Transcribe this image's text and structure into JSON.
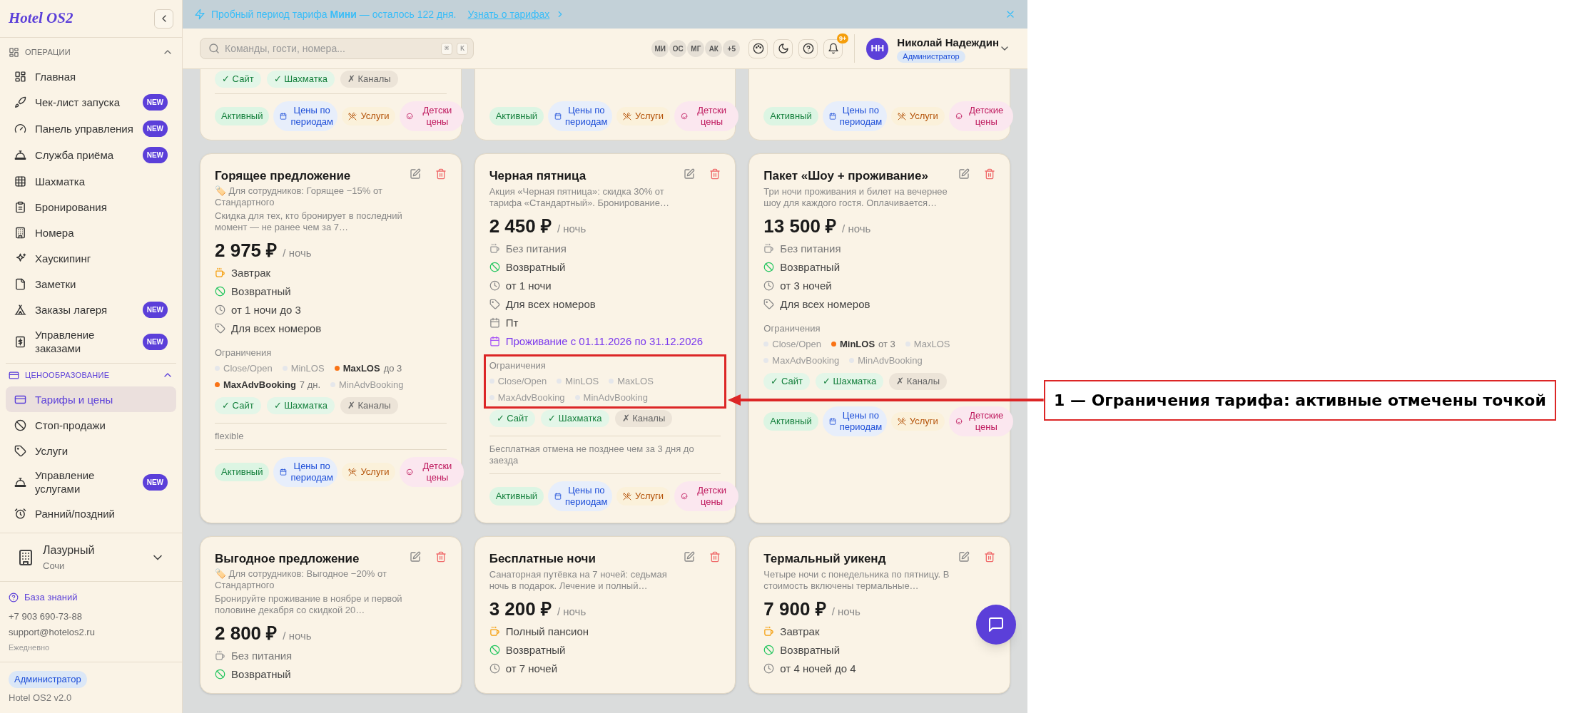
{
  "banner": {
    "text": "Пробный период тарифа **Мини** — осталось 122 дня.",
    "link": "Узнать о тарифах"
  },
  "sidebar": {
    "logo": "Hotel OS2",
    "sections": [
      {
        "title": "ОПЕРАЦИИ",
        "expanded": true,
        "items": [
          {
            "label": "Главная",
            "selected": false
          },
          {
            "label": "Чек-лист запуска",
            "badge": "NEW",
            "selected": false
          },
          {
            "label": "Панель управления",
            "badge": "NEW",
            "selected": false
          },
          {
            "label": "Служба приёма",
            "badge": "NEW",
            "selected": false
          },
          {
            "label": "Шахматка",
            "selected": false
          },
          {
            "label": "Бронирования",
            "selected": false
          },
          {
            "label": "Номера",
            "selected": false
          },
          {
            "label": "Хаускипинг",
            "selected": false
          },
          {
            "label": "Заметки",
            "selected": false
          },
          {
            "label": "Заказы лагеря",
            "badge": "NEW",
            "selected": false
          },
          {
            "label": "Управление заказами",
            "badge": "NEW",
            "selected": false
          }
        ]
      },
      {
        "title": "ЦЕНООБРАЗОВАНИЕ",
        "expanded": true,
        "items": [
          {
            "label": "Тарифы и цены",
            "selected": true
          },
          {
            "label": "Стоп-продажи",
            "selected": false
          },
          {
            "label": "Услуги",
            "selected": false
          },
          {
            "label": "Управление услугами",
            "badge": "NEW",
            "selected": false
          },
          {
            "label": "Ранний/поздний",
            "selected": false
          }
        ]
      }
    ],
    "hotel": {
      "name": "Лазурный",
      "city": "Сочи"
    },
    "support": {
      "link": "База знаний",
      "phone": "+7 903 690-73-88",
      "email": "support@hotelos2.ru",
      "hours": "Ежедневно"
    },
    "role": "Администратор",
    "version": "Hotel OS2 v2.0"
  },
  "header": {
    "search_placeholder": "Команды, гости, номера...",
    "keys": [
      "⌘",
      "K"
    ],
    "avatars": [
      "МИ",
      "ОС",
      "МГ",
      "АК"
    ],
    "more": "+5",
    "notifications": "9+",
    "user": {
      "initials": "НН",
      "name": "Николай Надеждин",
      "role": "Администратор"
    }
  },
  "top_cards": [
    {
      "channels": [
        {
          "label": "✓ Сайт",
          "enabled": true
        },
        {
          "label": "✓ Шахматка",
          "enabled": true
        },
        {
          "label": "✗ Каналы",
          "enabled": false
        }
      ],
      "statuses": [
        {
          "kind": "status",
          "text": "Активный"
        },
        {
          "kind": "periods",
          "text": "Цены по периодам"
        },
        {
          "kind": "services",
          "text": "Услуги"
        },
        {
          "kind": "kids",
          "text": "Детски цены"
        }
      ]
    },
    {
      "statuses": [
        {
          "kind": "status",
          "text": "Активный"
        },
        {
          "kind": "periods",
          "text": "Цены по периодам"
        },
        {
          "kind": "services",
          "text": "Услуги"
        },
        {
          "kind": "kids",
          "text": "Детски цены"
        }
      ]
    },
    {
      "statuses": [
        {
          "kind": "status",
          "text": "Активный"
        },
        {
          "kind": "periods",
          "text": "Цены по периодам"
        },
        {
          "kind": "services",
          "text": "Услуги"
        },
        {
          "kind": "kids",
          "text": "Детские цены"
        }
      ]
    }
  ],
  "cards": [
    {
      "title": "Горящее предложение",
      "staff_note": "🏷️ Для сотрудников: Горящее −15% от Стандартного",
      "description": "Скидка для тех, кто бронирует в последний момент — не ранее чем за 7…",
      "price": "2 975 ₽",
      "unit": "/ ночь",
      "features": [
        {
          "kind": "meal",
          "text": "Завтрак",
          "included": true
        },
        {
          "kind": "refund",
          "text": "Возвратный"
        },
        {
          "kind": "stay",
          "text": "от 1 ночи до 3"
        },
        {
          "kind": "rooms",
          "text": "Для всех номеров"
        }
      ],
      "restrictions_title": "Ограничения",
      "highlighted": false,
      "restrictions": [
        {
          "label": "Close/Open",
          "active": false
        },
        {
          "label": "MinLOS",
          "active": false
        },
        {
          "label": "MaxLOS",
          "value": "до 3",
          "active": true
        },
        {
          "label": "MaxAdvBooking",
          "value": "7 дн.",
          "active": true
        },
        {
          "label": "MinAdvBooking",
          "active": false
        }
      ],
      "channels": [
        {
          "label": "✓ Сайт",
          "enabled": true
        },
        {
          "label": "✓ Шахматка",
          "enabled": true
        },
        {
          "label": "✗ Каналы",
          "enabled": false
        }
      ],
      "note": "flexible",
      "statuses": [
        {
          "kind": "status",
          "text": "Активный"
        },
        {
          "kind": "periods",
          "text": "Цены по периодам"
        },
        {
          "kind": "services",
          "text": "Услуги"
        },
        {
          "kind": "kids",
          "text": "Детски цены"
        }
      ]
    },
    {
      "title": "Черная пятница",
      "description": "Акция «Черная пятница»: скидка 30% от тарифа «Стандартный». Бронирование…",
      "price": "2 450 ₽",
      "unit": "/ ночь",
      "features": [
        {
          "kind": "meal",
          "text": "Без питания",
          "included": false
        },
        {
          "kind": "refund",
          "text": "Возвратный"
        },
        {
          "kind": "stay",
          "text": "от 1 ночи"
        },
        {
          "kind": "rooms",
          "text": "Для всех номеров"
        },
        {
          "kind": "days",
          "text": "Пт"
        },
        {
          "kind": "period",
          "text": "Проживание с 01.11.2026 по 31.12.2026"
        }
      ],
      "restrictions_title": "Ограничения",
      "highlighted": true,
      "restrictions": [
        {
          "label": "Close/Open",
          "active": false
        },
        {
          "label": "MinLOS",
          "active": false
        },
        {
          "label": "MaxLOS",
          "active": false
        },
        {
          "label": "MaxAdvBooking",
          "active": false
        },
        {
          "label": "MinAdvBooking",
          "active": false
        }
      ],
      "channels": [
        {
          "label": "✓ Сайт",
          "enabled": true
        },
        {
          "label": "✓ Шахматка",
          "enabled": true
        },
        {
          "label": "✗ Каналы",
          "enabled": false
        }
      ],
      "note": "Бесплатная отмена не позднее чем за 3 дня до заезда",
      "statuses": [
        {
          "kind": "status",
          "text": "Активный"
        },
        {
          "kind": "periods",
          "text": "Цены по периодам"
        },
        {
          "kind": "services",
          "text": "Услуги"
        },
        {
          "kind": "kids",
          "text": "Детски цены"
        }
      ]
    },
    {
      "title": "Пакет «Шоу + проживание»",
      "description": "Три ночи проживания и билет на вечернее шоу для каждого гостя. Оплачивается…",
      "price": "13 500 ₽",
      "unit": "/ ночь",
      "features": [
        {
          "kind": "meal",
          "text": "Без питания",
          "included": false
        },
        {
          "kind": "refund",
          "text": "Возвратный"
        },
        {
          "kind": "stay",
          "text": "от 3 ночей"
        },
        {
          "kind": "rooms",
          "text": "Для всех номеров"
        }
      ],
      "restrictions_title": "Ограничения",
      "highlighted": false,
      "restrictions": [
        {
          "label": "Close/Open",
          "active": false
        },
        {
          "label": "MinLOS",
          "value": "от 3",
          "active": true
        },
        {
          "label": "MaxLOS",
          "active": false
        },
        {
          "label": "MaxAdvBooking",
          "active": false
        },
        {
          "label": "MinAdvBooking",
          "active": false
        }
      ],
      "channels": [
        {
          "label": "✓ Сайт",
          "enabled": true
        },
        {
          "label": "✓ Шахматка",
          "enabled": true
        },
        {
          "label": "✗ Каналы",
          "enabled": false
        }
      ],
      "statuses": [
        {
          "kind": "status",
          "text": "Активный"
        },
        {
          "kind": "periods",
          "text": "Цены по периодам"
        },
        {
          "kind": "services",
          "text": "Услуги"
        },
        {
          "kind": "kids",
          "text": "Детские цены"
        }
      ]
    },
    {
      "title": "Выгодное предложение",
      "staff_note": "🏷️ Для сотрудников: Выгодное −20% от Стандартного",
      "description": "Бронируйте проживание в ноябре и первой половине декабря со скидкой 20…",
      "price": "2 800 ₽",
      "unit": "/ ночь",
      "features": [
        {
          "kind": "meal",
          "text": "Без питания",
          "included": false
        },
        {
          "kind": "refund",
          "text": "Возвратный"
        }
      ]
    },
    {
      "title": "Бесплатные ночи",
      "description": "Санаторная путёвка на 7 ночей: седьмая ночь в подарок. Лечение и полный…",
      "price": "3 200 ₽",
      "unit": "/ ночь",
      "features": [
        {
          "kind": "meal",
          "text": "Полный пансион",
          "included": true
        },
        {
          "kind": "refund",
          "text": "Возвратный"
        },
        {
          "kind": "stay",
          "text": "от 7 ночей"
        }
      ]
    },
    {
      "title": "Термальный уикенд",
      "description": "Четыре ночи с понедельника по пятницу. В стоимость включены термальные…",
      "price": "7 900 ₽",
      "unit": "/ ночь",
      "features": [
        {
          "kind": "meal",
          "text": "Завтрак",
          "included": true
        },
        {
          "kind": "refund",
          "text": "Возвратный"
        },
        {
          "kind": "stay",
          "text": "от 4 ночей до 4"
        }
      ]
    }
  ],
  "annotation": {
    "text": "1 — Ограничения тарифа: активные отмечены точкой"
  }
}
